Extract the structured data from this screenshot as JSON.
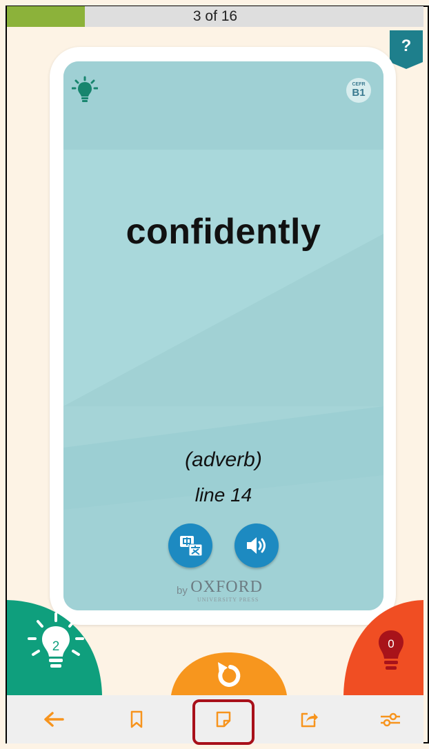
{
  "progress": {
    "label": "3 of 16",
    "fraction": 0.1875
  },
  "help": {
    "label": "?"
  },
  "card": {
    "word": "confidently",
    "part_of_speech": "(adverb)",
    "line_ref": "line 14",
    "cefr": {
      "caption": "CEFR",
      "level": "B1"
    },
    "byline": {
      "by": "by",
      "brand": "OXFORD",
      "press": "UNIVERSITY PRESS"
    },
    "colors": {
      "card": "#a8d6d9",
      "button": "#1d8ac1",
      "bulb": "#17856e"
    }
  },
  "counters": {
    "known": "2",
    "unknown": "0"
  },
  "colors": {
    "green": "#0f9f7d",
    "orange": "#f7961e",
    "red": "#f04e23",
    "accent": "#f7941d"
  },
  "toolbar": {
    "items": [
      {
        "name": "back",
        "icon": "arrow-left-icon"
      },
      {
        "name": "bookmark",
        "icon": "bookmark-icon"
      },
      {
        "name": "note",
        "icon": "sticky-note-icon"
      },
      {
        "name": "share",
        "icon": "share-icon"
      },
      {
        "name": "settings",
        "icon": "sliders-icon"
      }
    ]
  }
}
